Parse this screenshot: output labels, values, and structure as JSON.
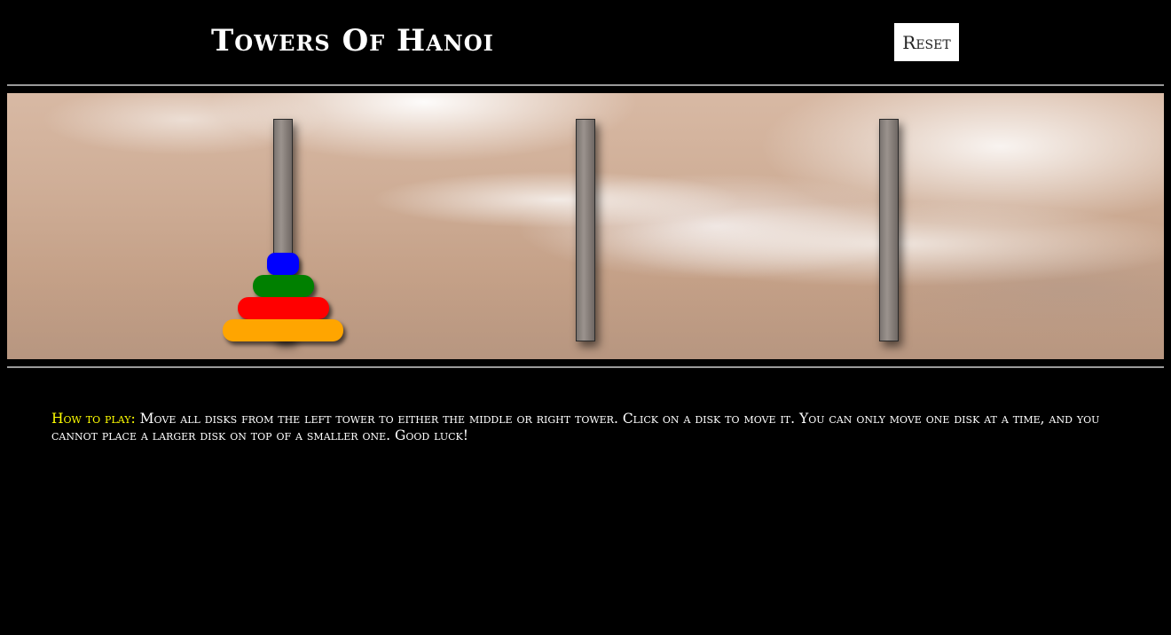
{
  "header": {
    "title": "Towers Of Hanoi",
    "reset_label": "Reset"
  },
  "board": {
    "towers": [
      {
        "name": "left",
        "disks": [
          "blue",
          "green",
          "red",
          "orange"
        ]
      },
      {
        "name": "middle",
        "disks": []
      },
      {
        "name": "right",
        "disks": []
      }
    ],
    "disk_colors": {
      "blue": "#0000ff",
      "green": "#008000",
      "red": "#ff0000",
      "orange": "#ffa500"
    }
  },
  "instructions": {
    "label": "How to play:",
    "text": " Move all disks from the left tower to either the middle or right tower. Click on a disk to move it. You can only move one disk at a time, and you cannot place a larger disk on top of a smaller one. Good luck!"
  },
  "colors": {
    "background": "#000000",
    "label_accent": "#ffff00"
  }
}
